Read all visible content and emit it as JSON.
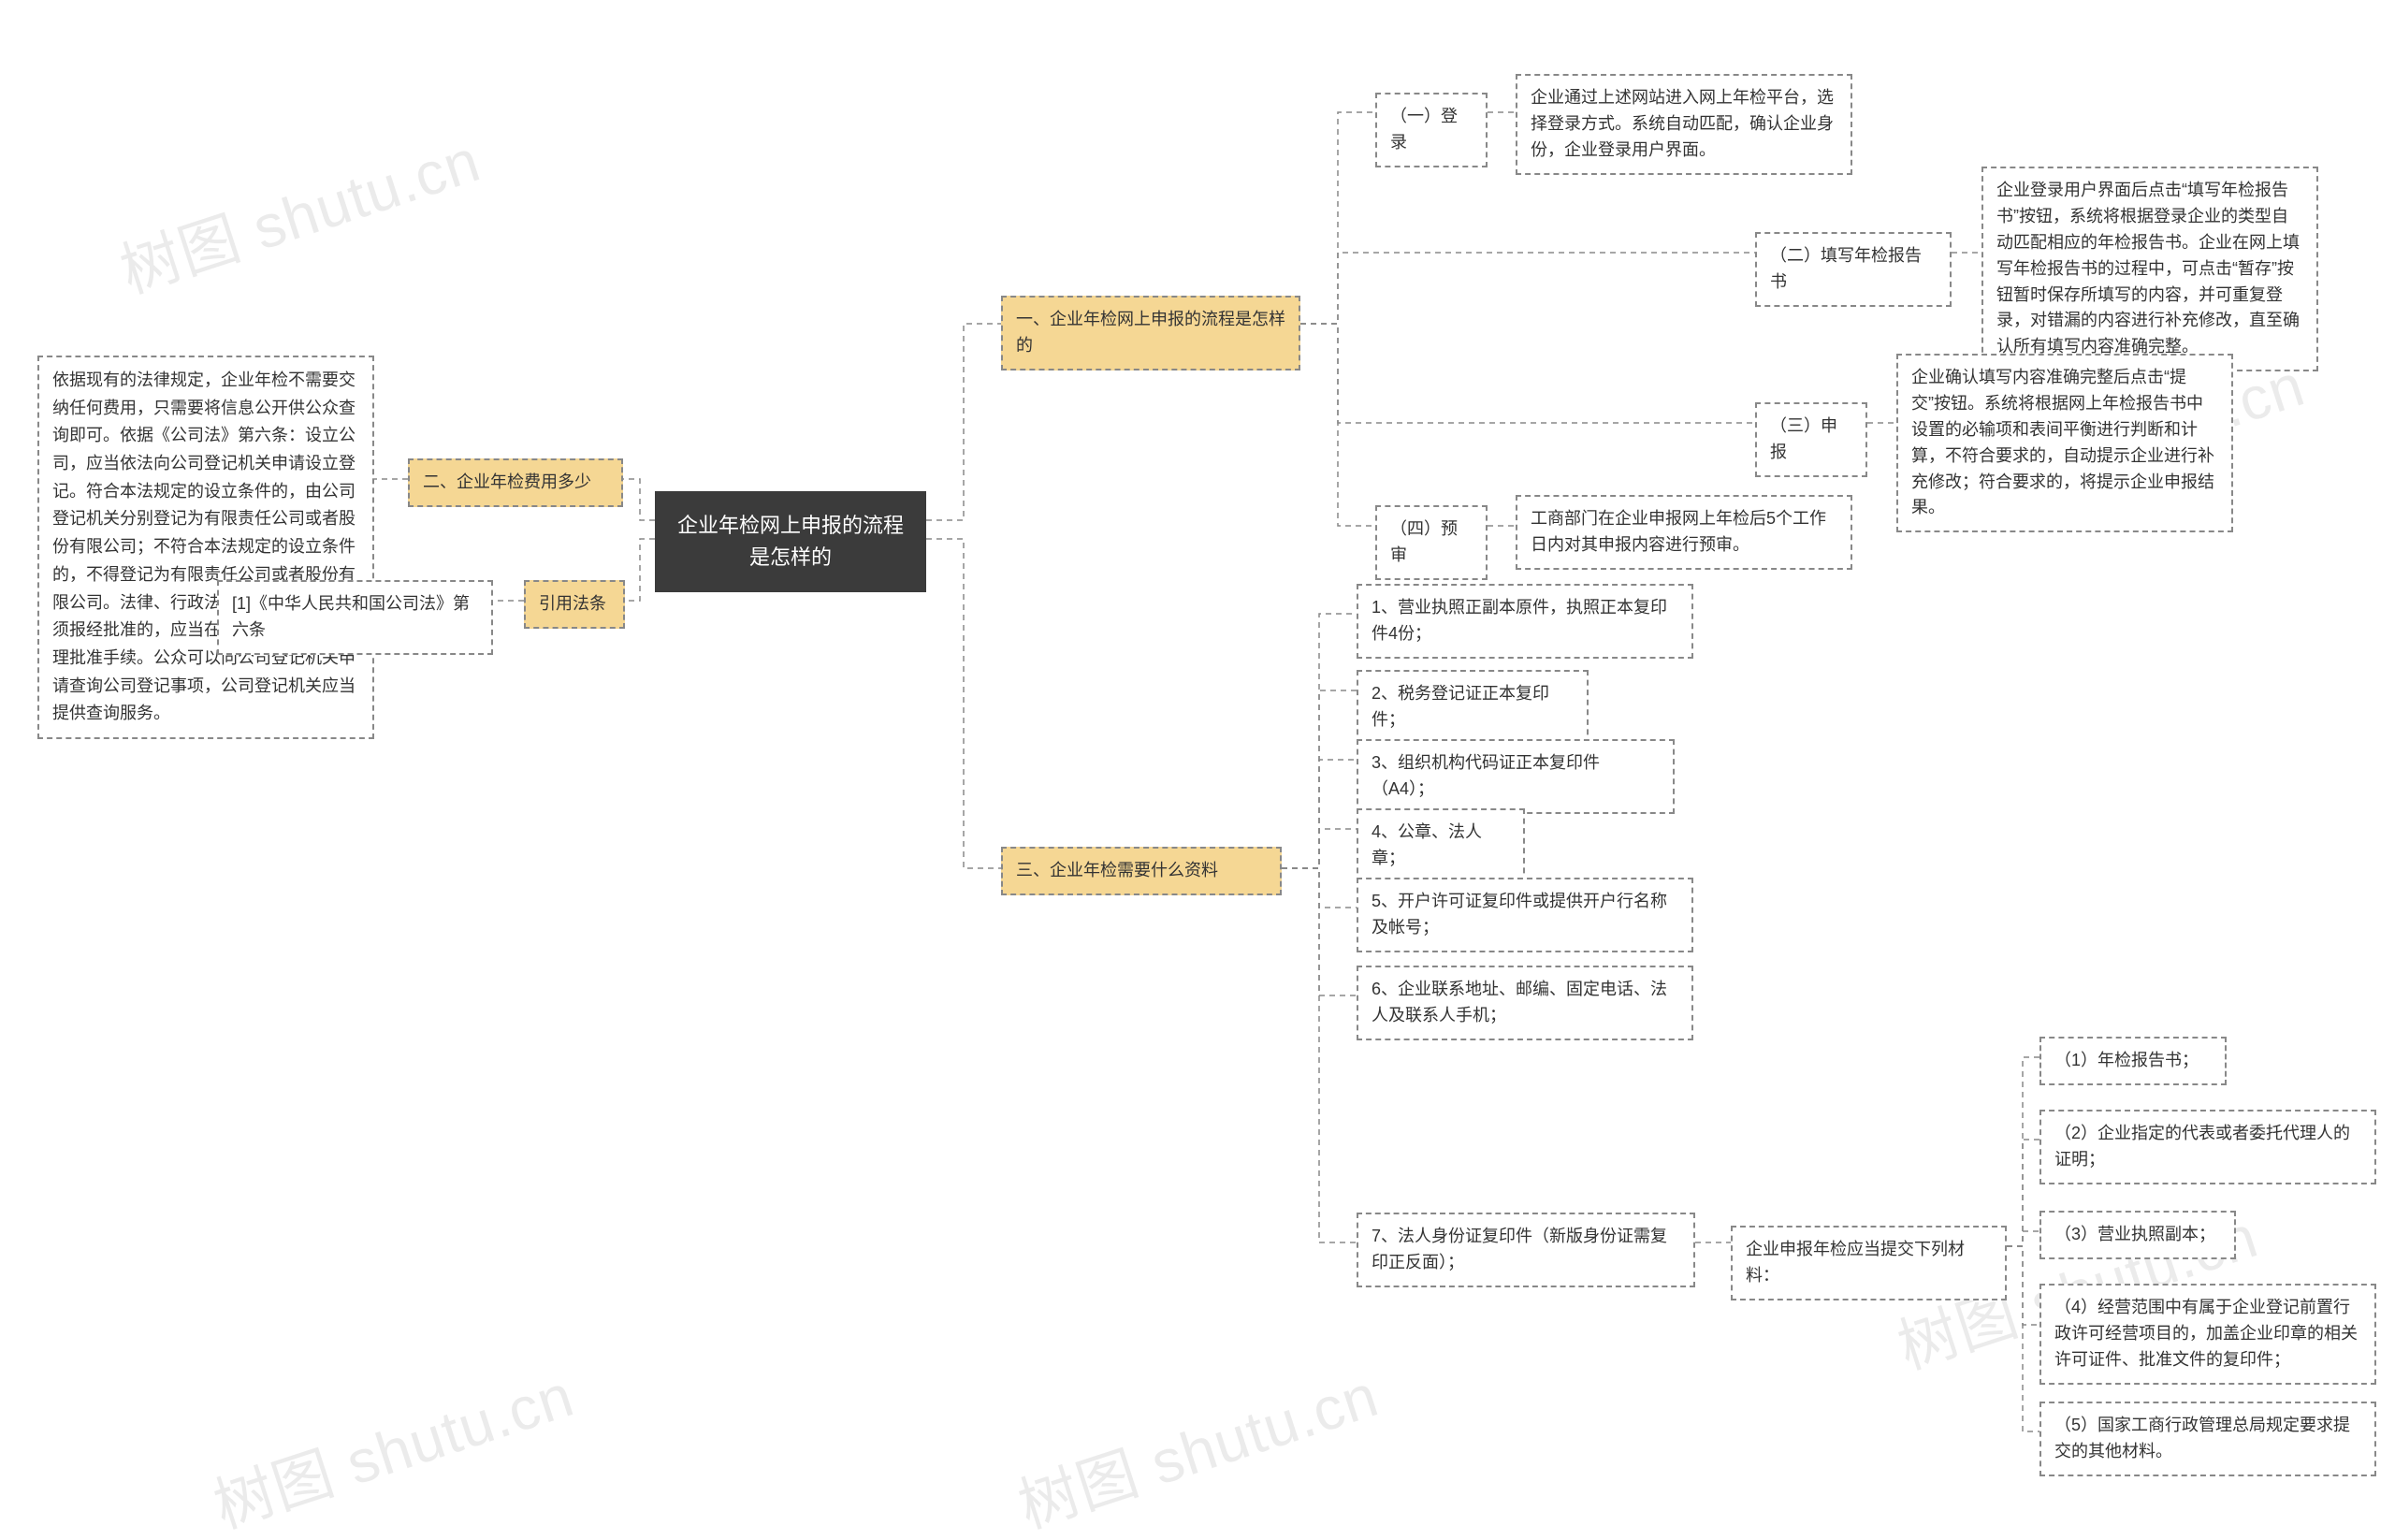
{
  "watermarks": [
    "树图 shutu.cn",
    "树图 shutu.cn",
    "树图 shutu.cn",
    "树图 shutu.cn",
    "树图 shutu.cn"
  ],
  "root": "企业年检网上申报的流程是怎样的",
  "left": {
    "fees": {
      "label": "二、企业年检费用多少",
      "text": "依据现有的法律规定，企业年检不需要交纳任何费用，只需要将信息公开供公众查询即可。依据《公司法》第六条：设立公司，应当依法向公司登记机关申请设立登记。符合本法规定的设立条件的，由公司登记机关分别登记为有限责任公司或者股份有限公司；不符合本法规定的设立条件的，不得登记为有限责任公司或者股份有限公司。法律、行政法规规定设立公司必须报经批准的，应当在公司登记前依法办理批准手续。公众可以向公司登记机关申请查询公司登记事项，公司登记机关应当提供查询服务。"
    },
    "cite": {
      "label": "引用法条",
      "text": "[1]《中华人民共和国公司法》第六条"
    }
  },
  "right": {
    "process": {
      "label": "一、企业年检网上申报的流程是怎样的",
      "steps": [
        {
          "label": "（一）登录",
          "text": "企业通过上述网站进入网上年检平台，选择登录方式。系统自动匹配，确认企业身份，企业登录用户界面。"
        },
        {
          "label": "（二）填写年检报告书",
          "text": "企业登录用户界面后点击“填写年检报告书”按钮，系统将根据登录企业的类型自动匹配相应的年检报告书。企业在网上填写年检报告书的过程中，可点击“暂存”按钮暂时保存所填写的内容，并可重复登录，对错漏的内容进行补充修改，直至确认所有填写内容准确完整。"
        },
        {
          "label": "（三）申报",
          "text": "企业确认填写内容准确完整后点击“提交”按钮。系统将根据网上年检报告书中设置的必输项和表间平衡进行判断和计算，不符合要求的，自动提示企业进行补充修改；符合要求的，将提示企业申报结果。"
        },
        {
          "label": "（四）预审",
          "text": "工商部门在企业申报网上年检后5个工作日内对其申报内容进行预审。"
        }
      ]
    },
    "docs": {
      "label": "三、企业年检需要什么资料",
      "items": [
        "1、营业执照正副本原件，执照正本复印件4份；",
        "2、税务登记证正本复印件；",
        "3、组织机构代码证正本复印件（A4）；",
        "4、公章、法人章；",
        "5、开户许可证复印件或提供开户行名称及帐号；",
        "6、企业联系地址、邮编、固定电话、法人及联系人手机；",
        "7、法人身份证复印件（新版身份证需复印正反面）；"
      ],
      "sub": {
        "label": "企业申报年检应当提交下列材料：",
        "items": [
          "（1）年检报告书；",
          "（2）企业指定的代表或者委托代理人的证明；",
          "（3）营业执照副本；",
          "（4）经营范围中有属于企业登记前置行政许可经营项目的，加盖企业印章的相关许可证件、批准文件的复印件；",
          "（5）国家工商行政管理总局规定要求提交的其他材料。"
        ]
      }
    }
  }
}
